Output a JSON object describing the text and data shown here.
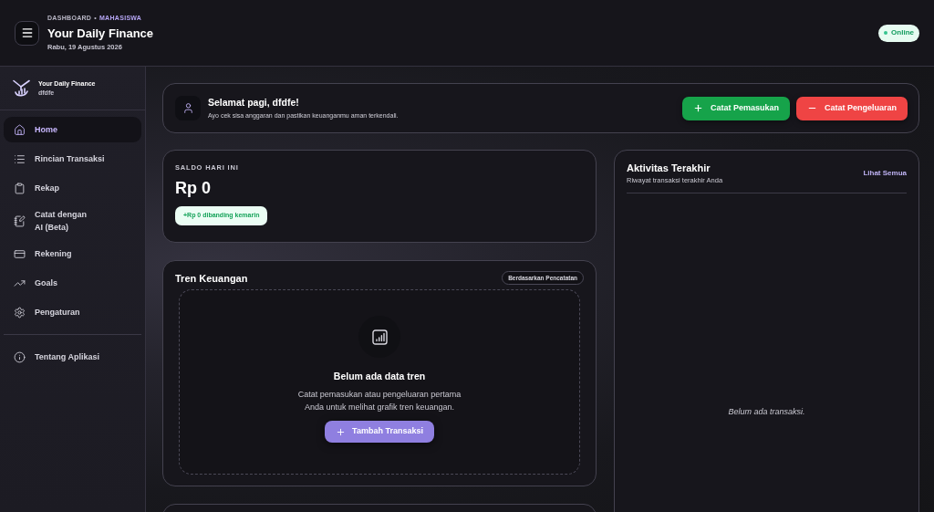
{
  "header": {
    "section": "DASHBOARD",
    "separator": "•",
    "role": "MAHASISWA",
    "title": "Your Daily Finance",
    "date": "Rabu, 19 Agustus 2026",
    "status": "Online"
  },
  "sidebar": {
    "app_name": "Your Daily Finance",
    "user": "dfdfe",
    "items": [
      {
        "label": "Home",
        "selected": true
      },
      {
        "label": "Rincian Transaksi",
        "selected": false
      },
      {
        "label": "Rekap",
        "selected": false
      },
      {
        "label": "Catat dengan\nAI (Beta)",
        "selected": false
      },
      {
        "label": "Rekening",
        "selected": false
      },
      {
        "label": "Goals",
        "selected": false
      },
      {
        "label": "Pengaturan",
        "selected": false
      }
    ],
    "footer_items": [
      {
        "label": "Tentang Aplikasi",
        "selected": false
      }
    ]
  },
  "greeting": {
    "title": "Selamat pagi, dfdfe!",
    "subtitle": "Ayo cek sisa anggaran dan pastikan keuanganmu aman terkendali.",
    "actions": [
      {
        "label": "Catat Pemasukan",
        "kind": "income"
      },
      {
        "label": "Catat Pengeluaran",
        "kind": "expense"
      }
    ]
  },
  "balance": {
    "label": "SALDO HARI INI",
    "amount": "Rp 0",
    "change": "+Rp 0 dibanding kemarin"
  },
  "trend": {
    "title": "Tren Keuangan",
    "badge": "Berdasarkan Pencatatan",
    "empty_title": "Belum ada data tren",
    "empty_text": "Catat pemasukan atau pengeluaran pertama\nAnda untuk melihat grafik tren keuangan.",
    "action": "Tambah Transaksi"
  },
  "activity": {
    "title": "Aktivitas Terakhir",
    "subtitle": "Riwayat transaksi terakhir Anda",
    "link": "Lihat Semua",
    "empty": "Belum ada transaksi."
  }
}
